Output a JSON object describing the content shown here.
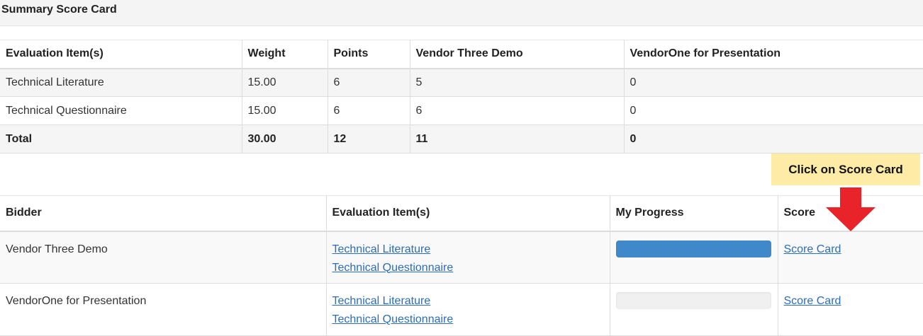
{
  "summary": {
    "title": "Summary Score Card",
    "headers": [
      "Evaluation Item(s)",
      "Weight",
      "Points",
      "Vendor Three Demo",
      "VendorOne for Presentation"
    ],
    "rows": [
      [
        "Technical Literature",
        "15.00",
        "6",
        "5",
        "0"
      ],
      [
        "Technical Questionnaire",
        "15.00",
        "6",
        "6",
        "0"
      ]
    ],
    "total": [
      "Total",
      "30.00",
      "12",
      "11",
      "0"
    ]
  },
  "callout": {
    "text": "Click on Score Card",
    "color": "#fdeba6",
    "arrow_color": "#e8232a"
  },
  "bidders": {
    "headers": [
      "Bidder",
      "Evaluation Item(s)",
      "My Progress",
      "Score"
    ],
    "rows": [
      {
        "name": "Vendor Three Demo",
        "items": [
          "Technical Literature",
          "Technical Questionnaire"
        ],
        "progress": 1.0,
        "action": "Score Card"
      },
      {
        "name": "VendorOne for Presentation",
        "items": [
          "Technical Literature",
          "Technical Questionnaire"
        ],
        "progress": 0.0,
        "action": "Score Card"
      }
    ]
  },
  "colors": {
    "link": "#2a6ebb",
    "progress_fill": "#3f88c9"
  }
}
